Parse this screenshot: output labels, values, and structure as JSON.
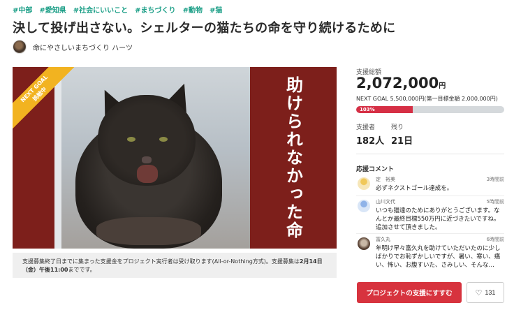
{
  "tags": [
    "#中部",
    "#愛知県",
    "#社会にいいこと",
    "#まちづくり",
    "#動物",
    "#猫"
  ],
  "title": "決して投げ出さない。シェルターの猫たちの命を守り続けるために",
  "owner": {
    "name": "命にやさしいまちづくり ハーツ"
  },
  "hero": {
    "banner_text": "助けられなかった命",
    "ribbon_line1": "NEXT GOAL",
    "ribbon_line2": "挑戦中"
  },
  "notice": {
    "text_prefix": "支援募集終了日までに集まった支援金をプロジェクト実行者は受け取ります(All-or-Nothing方式)。支援募集は",
    "text_bold": "2月14日（金）午後11:00",
    "text_suffix": "までです。"
  },
  "funding": {
    "label": "支援総額",
    "amount": "2,072,000",
    "unit": "円",
    "next_goal": "NEXT GOAL 5,500,000円(第一目標金額 2,000,000円)",
    "progress_label": "103%",
    "progress_fraction": 0.38,
    "progress_color": "#d62f45"
  },
  "stats": {
    "supporters_label": "支援者",
    "supporters_value": "182人",
    "remaining_label": "残り",
    "remaining_value": "21日"
  },
  "comments": {
    "title": "応援コメント",
    "items": [
      {
        "name": "定　裕美",
        "time": "3時間前",
        "text": "必ずネクストゴール達成を。"
      },
      {
        "name": "山川文代",
        "time": "5時間前",
        "text": "いつも猫達のためにありがとうございます。なんとか最終目標550万円に近づきたいですね。追加させて頂きました。"
      },
      {
        "name": "富久丸",
        "time": "6時間前",
        "text": "年明け早々富久丸を助けていただいたのに少しばかりでお恥ずかしいですが、暑い、寒い、痛い、怖い、お腹すいた、さみしい、そんな…"
      }
    ]
  },
  "actions": {
    "support_button": "プロジェクトの支援にすすむ",
    "favorite_count": "131"
  },
  "colors": {
    "accent": "#d7333e",
    "tag": "#1a9e86",
    "banner": "#7d1f1b",
    "ribbon": "#f2b320"
  }
}
